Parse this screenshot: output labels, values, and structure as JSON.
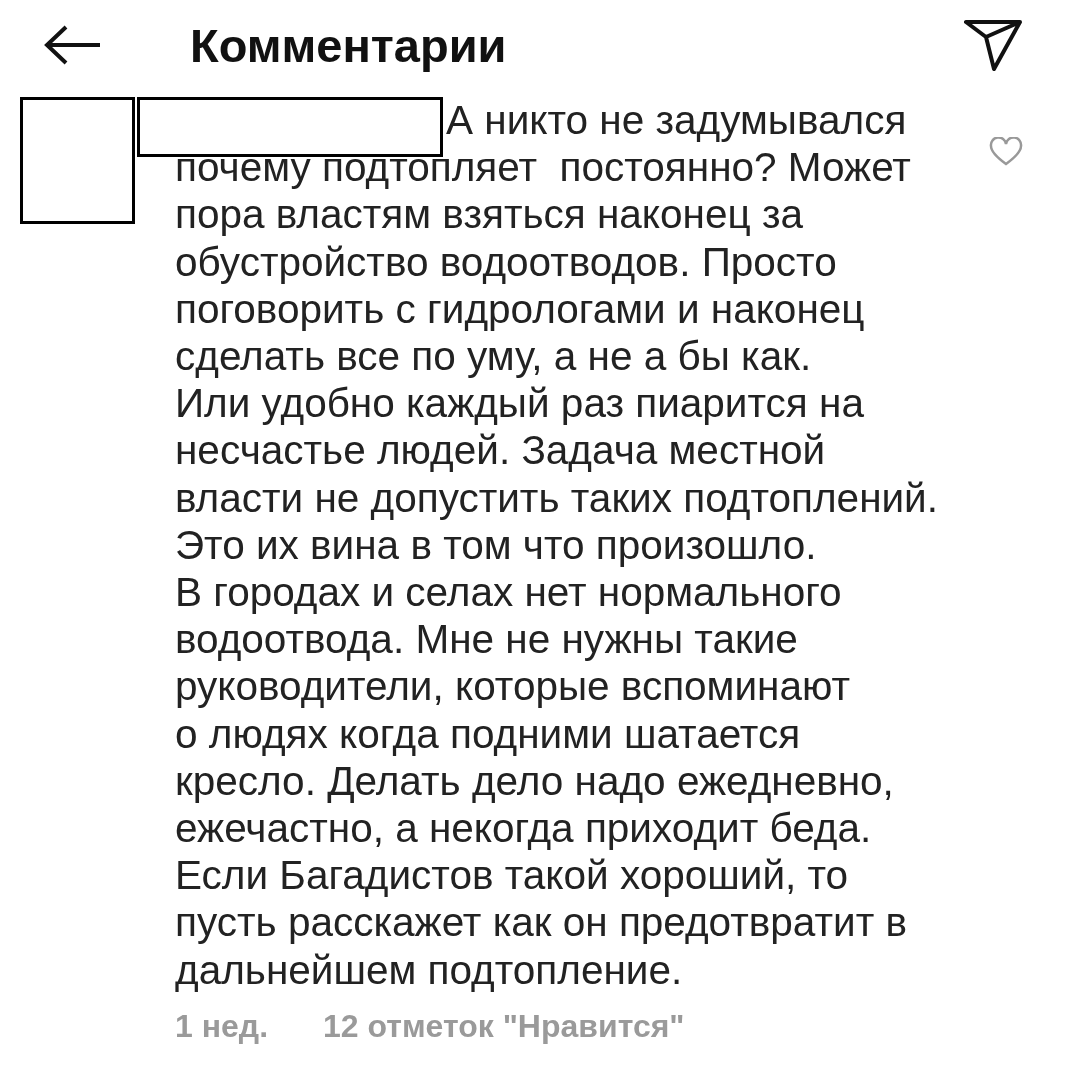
{
  "header": {
    "title": "Комментарии"
  },
  "comment": {
    "text": "А никто не задумывался\nпочему подтопляет  постоянно? Может\nпора властям взяться наконец за\nобустройство водоотводов. Просто\nпоговорить с гидрологами и наконец\nсделать все по уму, а не а бы как.\nИли удобно каждый раз пиарится на\nнесчастье людей. Задача местной\nвласти не допустить таких подтоплений.\nЭто их вина в том что произошло.\nВ городах и селах нет нормального\nводоотвода. Мне не нужны такие\nруководители, которые вспоминают\nо людях когда подними шатается\nкресло. Делать дело надо ежедневно,\nежечастно, а некогда приходит беда.\nЕсли Багадистов такой хороший, то\nпусть расскажет как он предотвратит в\nдальнейшем подтопление.",
    "liked": false,
    "time": "1 нед.",
    "likes": "12 отметок \"Нравится\""
  }
}
